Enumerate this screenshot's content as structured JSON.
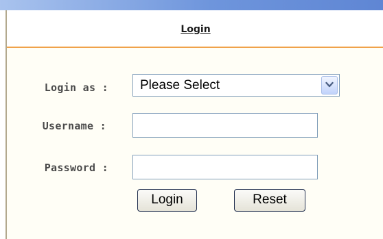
{
  "header": {
    "title": "Login"
  },
  "form": {
    "login_as": {
      "label": "Login as :",
      "selected_value": "Please Select"
    },
    "username": {
      "label": "Username :",
      "value": ""
    },
    "password": {
      "label": "Password :",
      "value": ""
    },
    "buttons": {
      "login_label": "Login",
      "reset_label": "Reset"
    }
  },
  "icons": {
    "dropdown": "chevron-down-icon"
  },
  "colors": {
    "top_bar": "#6e95dc",
    "header_rule": "#f0a24a",
    "panel_background": "#fffef6",
    "input_border": "#7f9db9"
  }
}
